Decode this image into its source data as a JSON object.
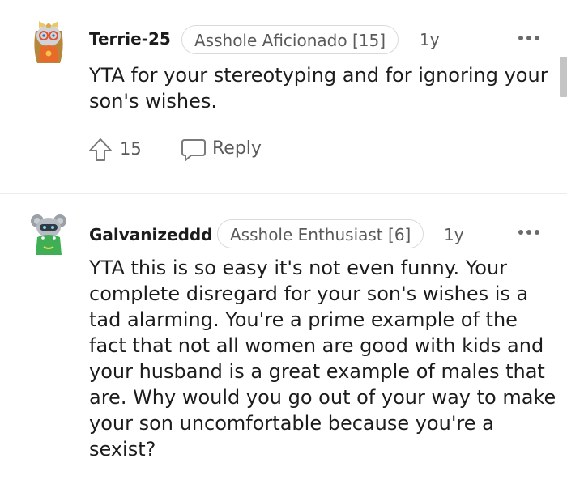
{
  "comments": [
    {
      "username": "Terrie-25",
      "flair": "Asshole Aficionado [15]",
      "age": "1y",
      "text": "YTA for your stereotyping and for ignoring your son's wishes.",
      "votes": "15",
      "reply_label": "Reply",
      "avatar_icon": "snoo-avatar-icon"
    },
    {
      "username": "Galvanizeddd",
      "flair": "Asshole Enthusiast [6]",
      "age": "1y",
      "text": "YTA this is so easy it's not even funny. Your complete disregard for your son's wishes is a tad alarming. You're a prime example of the fact that not all women are good with kids and your husband is a great example of males that are. Why would you go out of your way to make your son uncomfortable because you're a sexist?",
      "avatar_icon": "snoo-avatar-icon"
    }
  ],
  "colors": {
    "text": "#1c1c1c",
    "meta": "#5a5a5a",
    "flair_border": "#dadada",
    "divider": "#ececec"
  }
}
